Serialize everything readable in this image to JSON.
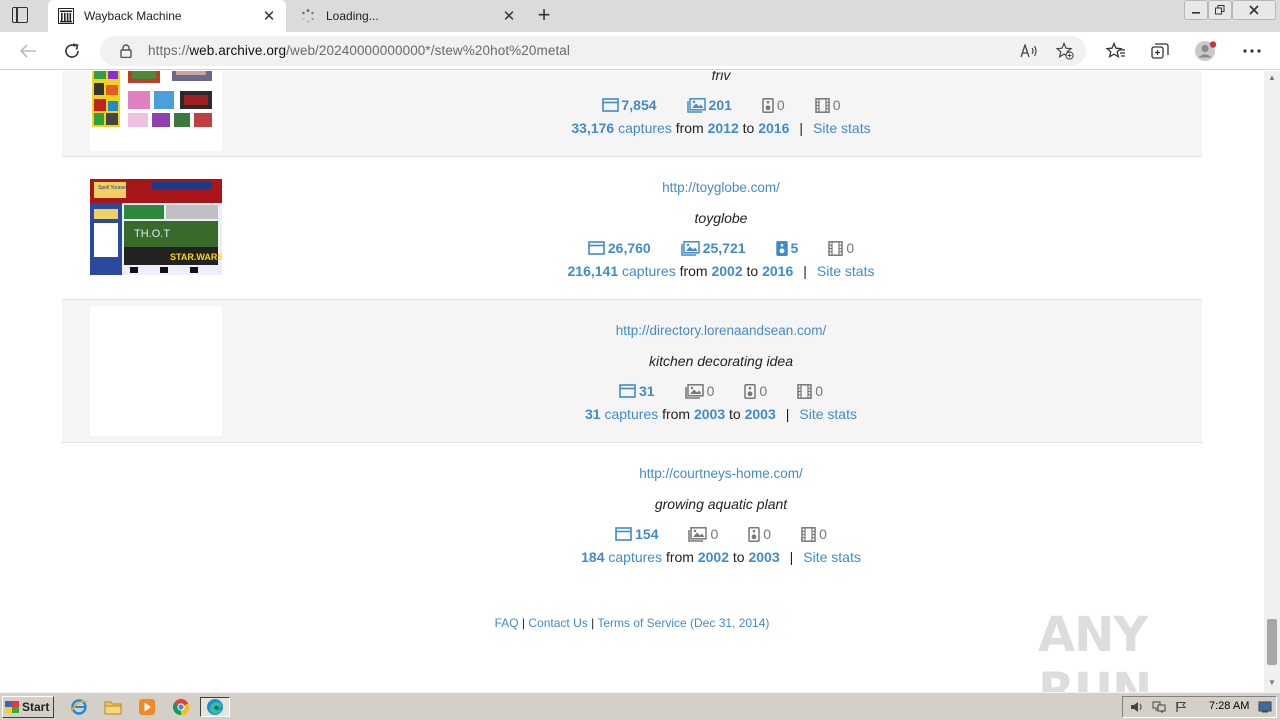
{
  "browser": {
    "tabs": [
      {
        "title": "Wayback Machine",
        "state": "active"
      },
      {
        "title": "Loading...",
        "state": "loading"
      }
    ],
    "url": {
      "prefix": "https://",
      "host": "web.archive.org",
      "path": "/web/20240000000000*/stew%20hot%20metal"
    }
  },
  "results": [
    {
      "url": "",
      "title": "friv",
      "counts": {
        "html": "7,854",
        "images": "201",
        "audio": "0",
        "video": "0"
      },
      "captures": "33,176",
      "captures_label": "captures",
      "from_label": "from",
      "from_year": "2012",
      "to_label": "to",
      "to_year": "2016",
      "separator": "|",
      "stats_label": "Site stats",
      "has_thumb": "yes"
    },
    {
      "url": "http://toyglobe.com/",
      "title": "toyglobe",
      "counts": {
        "html": "26,760",
        "images": "25,721",
        "audio": "5",
        "video": "0"
      },
      "captures": "216,141",
      "captures_label": "captures",
      "from_label": "from",
      "from_year": "2002",
      "to_label": "to",
      "to_year": "2016",
      "separator": "|",
      "stats_label": "Site stats",
      "has_thumb": "yes"
    },
    {
      "url": "http://directory.lorenaandsean.com/",
      "title": "kitchen decorating idea",
      "counts": {
        "html": "31",
        "images": "0",
        "audio": "0",
        "video": "0"
      },
      "captures": "31",
      "captures_label": "captures",
      "from_label": "from",
      "from_year": "2003",
      "to_label": "to",
      "to_year": "2003",
      "separator": "|",
      "stats_label": "Site stats",
      "has_thumb": "blank"
    },
    {
      "url": "http://courtneys-home.com/",
      "title": "growing aquatic plant",
      "counts": {
        "html": "154",
        "images": "0",
        "audio": "0",
        "video": "0"
      },
      "captures": "184",
      "captures_label": "captures",
      "from_label": "from",
      "from_year": "2002",
      "to_label": "to",
      "to_year": "2003",
      "separator": "|",
      "stats_label": "Site stats",
      "has_thumb": "none"
    }
  ],
  "footer": {
    "faq": "FAQ",
    "sep1": " | ",
    "contact": "Contact Us",
    "sep2": " | ",
    "terms": "Terms of Service (Dec 31, 2014)"
  },
  "watermark": "ANY RUN",
  "taskbar": {
    "start": "Start",
    "clock": "7:28 AM"
  },
  "colors": {
    "link": "#428bca",
    "zero_count": "#777777",
    "shaded_row": "#f5f5f5"
  }
}
